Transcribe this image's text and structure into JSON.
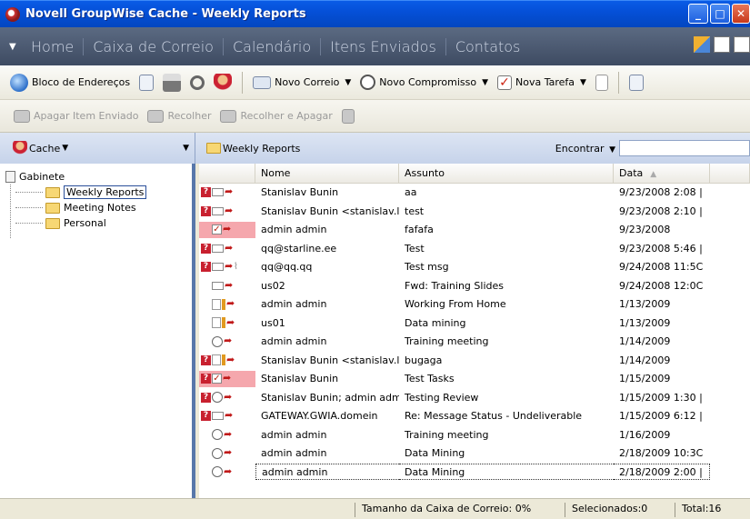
{
  "window": {
    "title": "Novell GroupWise Cache - Weekly Reports"
  },
  "nav": {
    "items": [
      "Home",
      "Caixa de Correio",
      "Calendário",
      "Itens Enviados",
      "Contatos"
    ]
  },
  "toolbar": {
    "address_book": "Bloco de Endereços",
    "new_mail": "Novo Correio",
    "new_appointment": "Novo Compromisso",
    "new_task": "Nova Tarefa",
    "delete_sent": "Apagar Item Enviado",
    "retract": "Recolher",
    "retract_delete": "Recolher e Apagar"
  },
  "left": {
    "cache_label": "Cache",
    "tree_root": "Gabinete",
    "folders": [
      "Weekly Reports",
      "Meeting Notes",
      "Personal"
    ]
  },
  "right": {
    "folder_title": "Weekly Reports",
    "find_label": "Encontrar",
    "columns": {
      "name": "Nome",
      "subject": "Assunto",
      "date": "Data"
    }
  },
  "rows": [
    {
      "icons": "qmail",
      "name": "Stanislav Bunin",
      "subject": "aa",
      "date": "9/23/2008 2:08 |"
    },
    {
      "icons": "qmail",
      "name": "Stanislav Bunin <stanislav.l",
      "subject": "test",
      "date": "9/23/2008 2:10 |"
    },
    {
      "icons": "task-hl",
      "name": "admin admin",
      "subject": "fafafa",
      "date": "9/23/2008"
    },
    {
      "icons": "qmail",
      "name": "qq@starline.ee",
      "subject": "Test",
      "date": "9/23/2008 5:46 |"
    },
    {
      "icons": "qmail-clip",
      "name": "qq@qq.qq",
      "subject": "Test msg",
      "date": "9/24/2008 11:5C"
    },
    {
      "icons": "mail",
      "name": "us02",
      "subject": "Fwd: Training Slides",
      "date": "9/24/2008 12:0C"
    },
    {
      "icons": "note",
      "name": "admin admin",
      "subject": "Working From Home",
      "date": "1/13/2009"
    },
    {
      "icons": "note",
      "name": "us01",
      "subject": "Data mining",
      "date": "1/13/2009"
    },
    {
      "icons": "appt",
      "name": "admin admin",
      "subject": "Training meeting",
      "date": "1/14/2009"
    },
    {
      "icons": "qnote",
      "name": "Stanislav Bunin <stanislav.l",
      "subject": "bugaga",
      "date": "1/14/2009"
    },
    {
      "icons": "qtask-hl",
      "name": "Stanislav Bunin",
      "subject": "Test Tasks",
      "date": "1/15/2009"
    },
    {
      "icons": "qappt",
      "name": "Stanislav Bunin;  admin adm",
      "subject": "Testing Review",
      "date": "1/15/2009 1:30 |"
    },
    {
      "icons": "qmail",
      "name": "GATEWAY.GWIA.domein",
      "subject": "Re: Message Status - Undeliverable",
      "date": "1/15/2009 6:12 |"
    },
    {
      "icons": "clock",
      "name": "admin admin",
      "subject": "Training meeting",
      "date": "1/16/2009"
    },
    {
      "icons": "clock",
      "name": "admin admin",
      "subject": "Data Mining",
      "date": "2/18/2009 10:3C"
    },
    {
      "icons": "clock",
      "name": "admin admin",
      "subject": "Data Mining",
      "date": "2/18/2009 2:00 |",
      "focused": true
    }
  ],
  "status": {
    "mailbox_size": "Tamanho da Caixa de Correio: 0%",
    "selected": "Selecionados:0",
    "total": "Total:16"
  }
}
